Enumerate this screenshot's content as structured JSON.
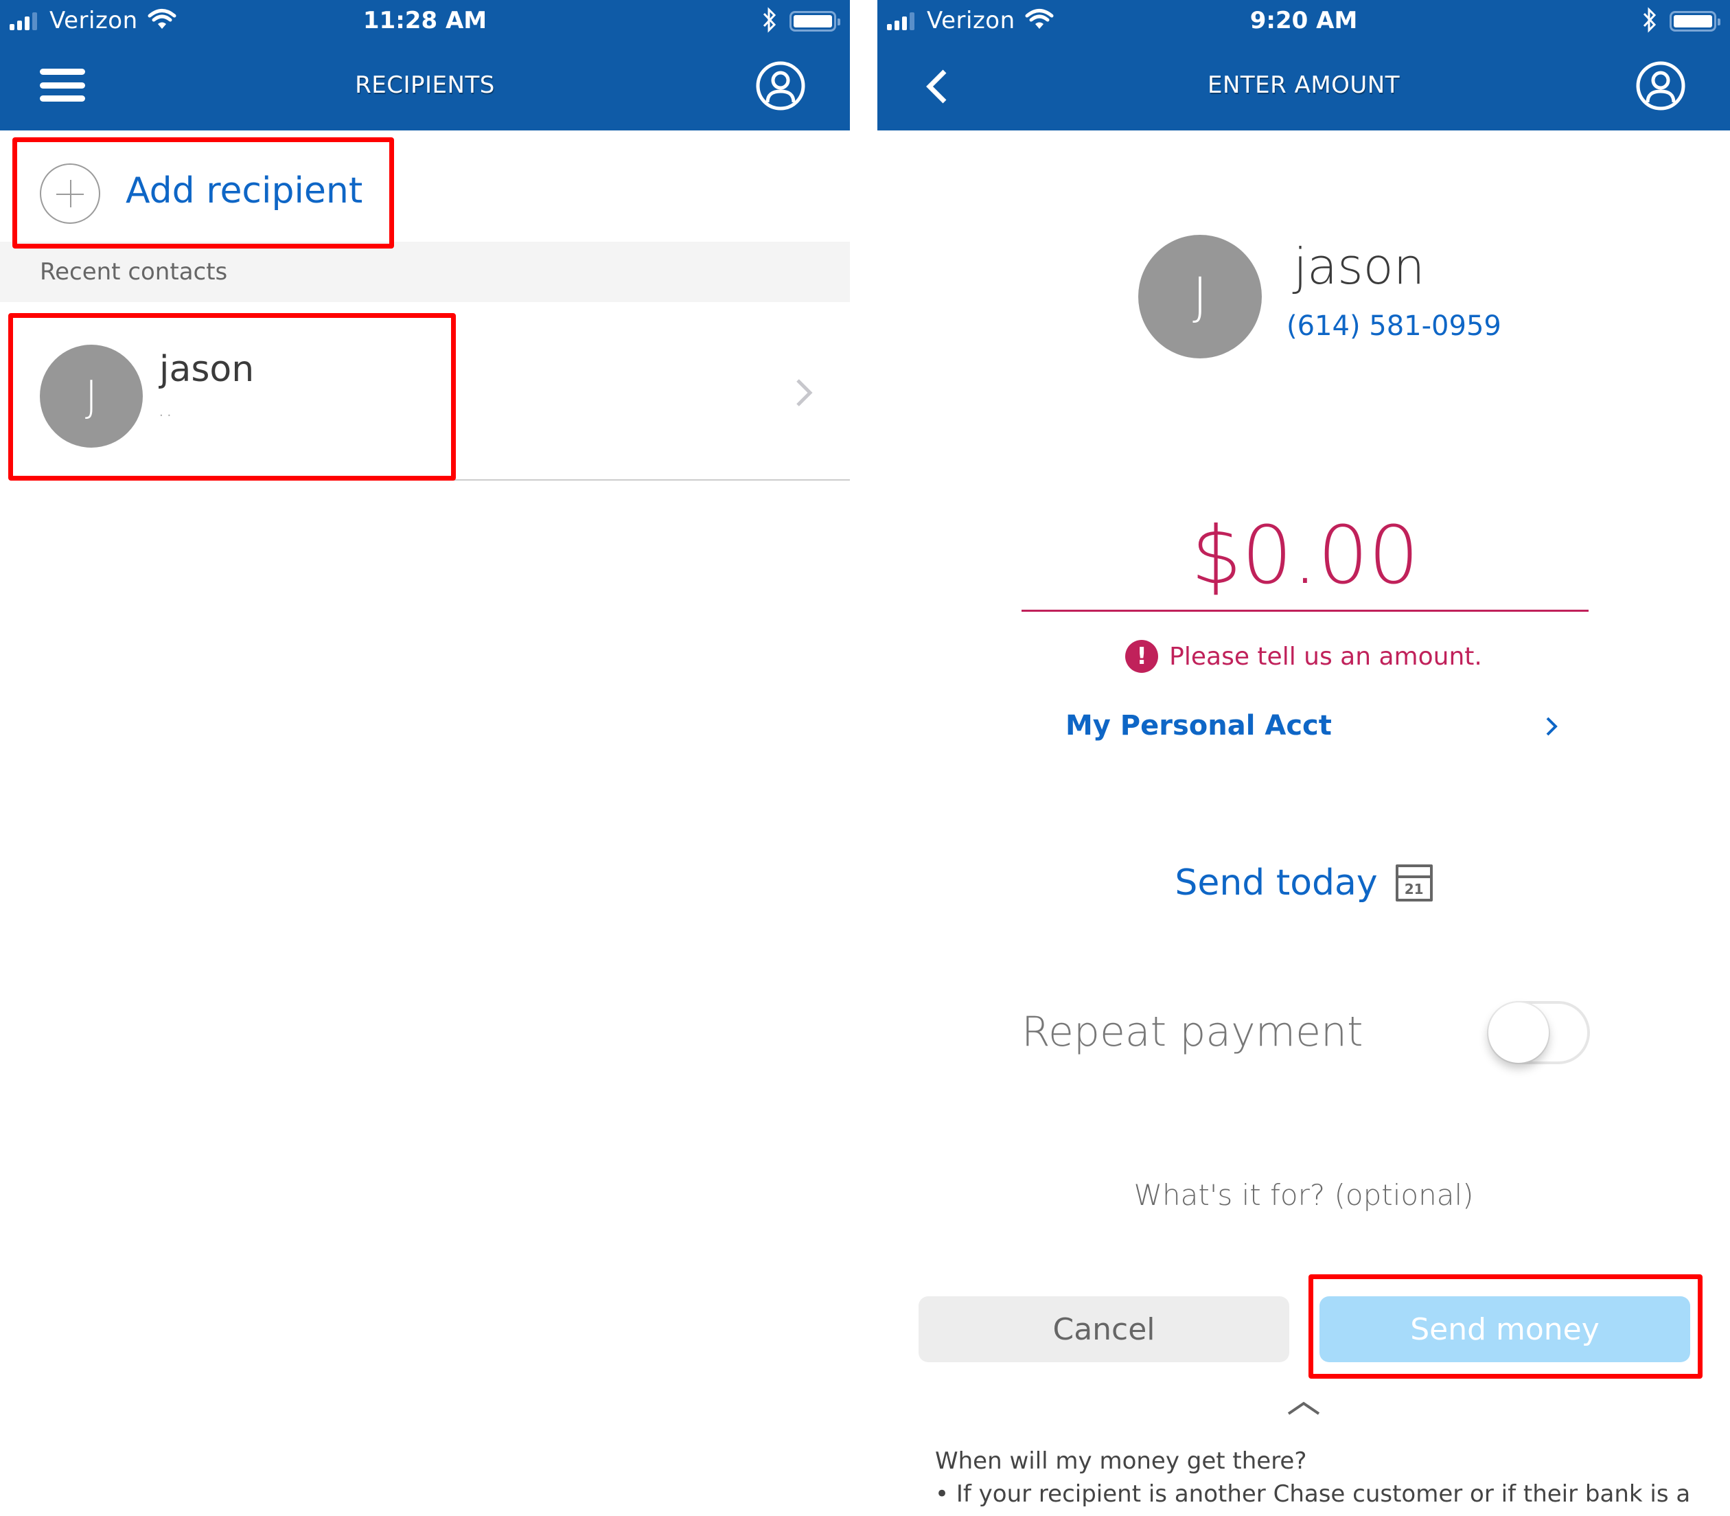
{
  "left_screen": {
    "status_bar": {
      "carrier": "Verizon",
      "time": "11:28 AM",
      "signal_bars": 3,
      "signal_max": 4,
      "battery_level": 1.0
    },
    "nav": {
      "title": "RECIPIENTS",
      "left_icon": "hamburger-menu-icon",
      "right_icon": "profile-icon"
    },
    "add_recipient": {
      "label": "Add recipient",
      "icon": "plus-circle-icon"
    },
    "section_label": "Recent contacts",
    "contacts": [
      {
        "initial": "J",
        "name": "jason",
        "detail": ".                            .",
        "icon": "chevron-right-icon"
      }
    ]
  },
  "right_screen": {
    "status_bar": {
      "carrier": "Verizon",
      "time": "9:20 AM",
      "signal_bars": 3,
      "signal_max": 4,
      "battery_level": 1.0
    },
    "nav": {
      "title": "ENTER AMOUNT",
      "left_icon": "back-chevron-icon",
      "right_icon": "profile-icon"
    },
    "recipient": {
      "initial": "J",
      "name": "jason",
      "phone": "(614) 581-0959"
    },
    "amount": "$0.00",
    "error": {
      "icon": "!",
      "message": "Please tell us an amount."
    },
    "account": {
      "label": "My Personal Acct"
    },
    "send_date": {
      "label": "Send today",
      "calendar_day": "21"
    },
    "repeat_payment": {
      "label": "Repeat payment",
      "enabled": false
    },
    "memo_placeholder": "What's it for? (optional)",
    "buttons": {
      "cancel": "Cancel",
      "send": "Send money"
    },
    "help": {
      "title": "When will my money get there?",
      "bullet": "• If your recipient is another Chase customer or if their bank is a"
    }
  },
  "colors": {
    "header_blue": "#0F5BA7",
    "link_blue": "#0E66C6",
    "error_red": "#C0215A",
    "send_button_disabled": "#A7DBFA",
    "annotation_red": "#FF0000"
  }
}
